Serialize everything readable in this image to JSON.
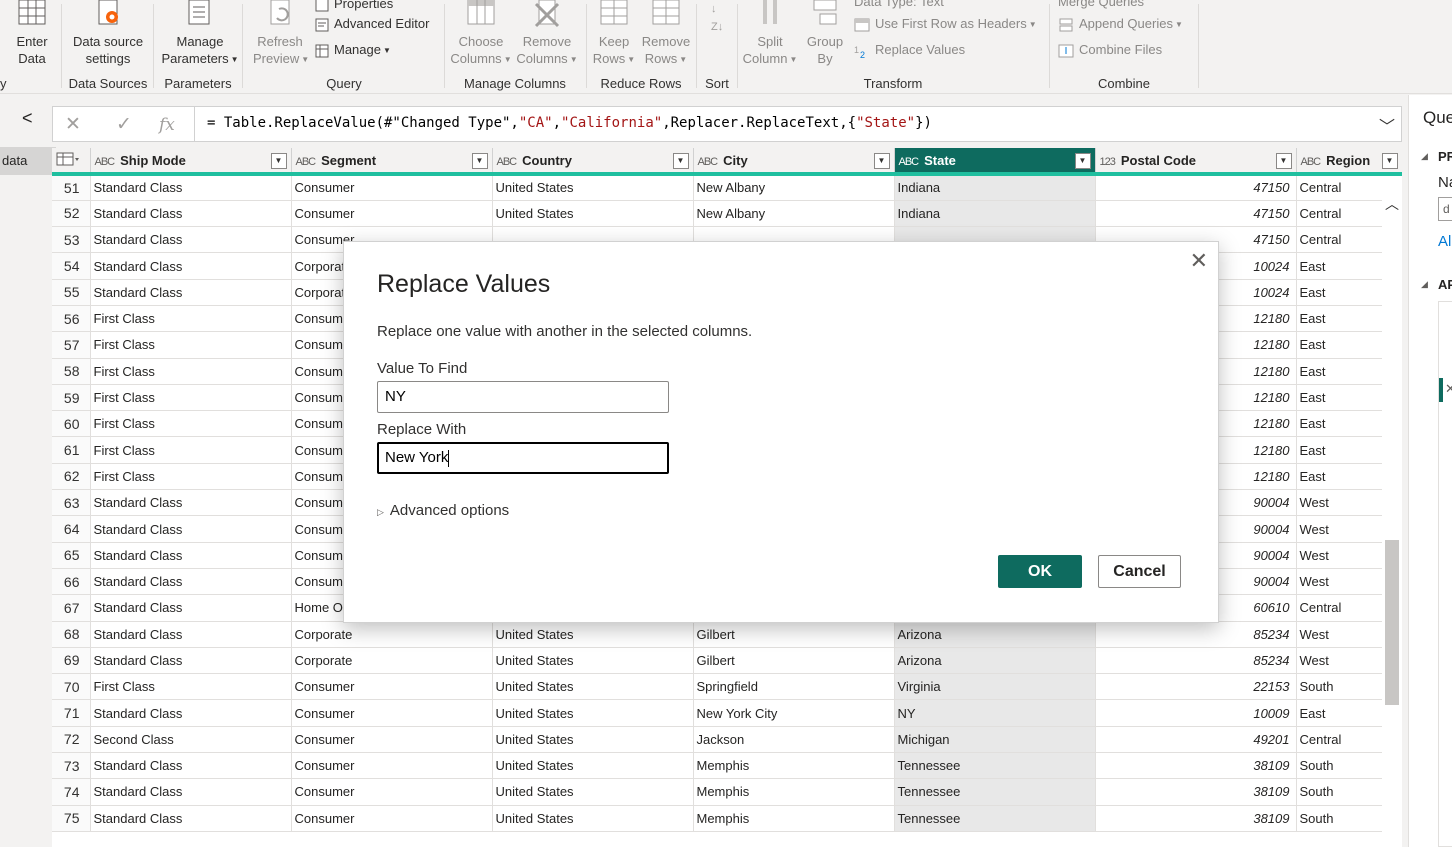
{
  "ribbon": {
    "enter_data": "Enter\nData",
    "data_source_settings": "Data source\nsettings",
    "manage_parameters": "Manage\nParameters",
    "refresh_preview": "Refresh\nPreview",
    "properties": "Properties",
    "advanced_editor": "Advanced Editor",
    "manage": "Manage",
    "choose_columns": "Choose\nColumns",
    "remove_columns": "Remove\nColumns",
    "keep_rows": "Keep\nRows",
    "remove_rows": "Remove\nRows",
    "split_column": "Split\nColumn",
    "group_by": "Group\nBy",
    "data_type": "Data Type: Text",
    "use_first_row": "Use First Row as Headers",
    "replace_values": "Replace Values",
    "merge_queries": "Merge Queries",
    "append_queries": "Append Queries",
    "combine_files": "Combine Files",
    "groups": {
      "first": "y",
      "data_sources": "Data Sources",
      "parameters": "Parameters",
      "query": "Query",
      "manage_columns": "Manage Columns",
      "reduce_rows": "Reduce Rows",
      "sort": "Sort",
      "transform": "Transform",
      "combine": "Combine"
    }
  },
  "left_pane": {
    "item": "data"
  },
  "formula_bar": {
    "fx": "fx",
    "prefix": "= Table.ReplaceValue(#\"Changed Type\",",
    "s1": "\"CA\"",
    "comma1": ",",
    "s2": "\"California\"",
    "mid": ",Replacer.ReplaceText,{",
    "s3": "\"State\"",
    "suffix": "})"
  },
  "grid": {
    "columns": [
      {
        "type": "ABC",
        "name": "Ship Mode"
      },
      {
        "type": "ABC",
        "name": "Segment"
      },
      {
        "type": "ABC",
        "name": "Country"
      },
      {
        "type": "ABC",
        "name": "City"
      },
      {
        "type": "ABC",
        "name": "State",
        "selected": true
      },
      {
        "type": "123",
        "name": "Postal Code"
      },
      {
        "type": "ABC",
        "name": "Region"
      }
    ],
    "rows": [
      [
        "51",
        "Standard Class",
        "Consumer",
        "United States",
        "New Albany",
        "Indiana",
        "47150",
        "Central"
      ],
      [
        "52",
        "Standard Class",
        "Consumer",
        "United States",
        "New Albany",
        "Indiana",
        "47150",
        "Central"
      ],
      [
        "53",
        "Standard Class",
        "Consumer",
        "",
        "",
        "",
        "47150",
        "Central"
      ],
      [
        "54",
        "Standard Class",
        "Corporate",
        "",
        "",
        "",
        "10024",
        "East"
      ],
      [
        "55",
        "Standard Class",
        "Corporate",
        "",
        "",
        "",
        "10024",
        "East"
      ],
      [
        "56",
        "First Class",
        "Consumer",
        "",
        "",
        "",
        "12180",
        "East"
      ],
      [
        "57",
        "First Class",
        "Consumer",
        "",
        "",
        "",
        "12180",
        "East"
      ],
      [
        "58",
        "First Class",
        "Consumer",
        "",
        "",
        "",
        "12180",
        "East"
      ],
      [
        "59",
        "First Class",
        "Consumer",
        "",
        "",
        "",
        "12180",
        "East"
      ],
      [
        "60",
        "First Class",
        "Consumer",
        "",
        "",
        "",
        "12180",
        "East"
      ],
      [
        "61",
        "First Class",
        "Consumer",
        "",
        "",
        "",
        "12180",
        "East"
      ],
      [
        "62",
        "First Class",
        "Consumer",
        "",
        "",
        "",
        "12180",
        "East"
      ],
      [
        "63",
        "Standard Class",
        "Consumer",
        "",
        "",
        "",
        "90004",
        "West"
      ],
      [
        "64",
        "Standard Class",
        "Consumer",
        "",
        "",
        "",
        "90004",
        "West"
      ],
      [
        "65",
        "Standard Class",
        "Consumer",
        "",
        "",
        "",
        "90004",
        "West"
      ],
      [
        "66",
        "Standard Class",
        "Consumer",
        "",
        "",
        "",
        "90004",
        "West"
      ],
      [
        "67",
        "Standard Class",
        "Home Office",
        "",
        "",
        "",
        "60610",
        "Central"
      ],
      [
        "68",
        "Standard Class",
        "Corporate",
        "United States",
        "Gilbert",
        "Arizona",
        "85234",
        "West"
      ],
      [
        "69",
        "Standard Class",
        "Corporate",
        "United States",
        "Gilbert",
        "Arizona",
        "85234",
        "West"
      ],
      [
        "70",
        "First Class",
        "Consumer",
        "United States",
        "Springfield",
        "Virginia",
        "22153",
        "South"
      ],
      [
        "71",
        "Standard Class",
        "Consumer",
        "United States",
        "New York City",
        "NY",
        "10009",
        "East"
      ],
      [
        "72",
        "Second Class",
        "Consumer",
        "United States",
        "Jackson",
        "Michigan",
        "49201",
        "Central"
      ],
      [
        "73",
        "Standard Class",
        "Consumer",
        "United States",
        "Memphis",
        "Tennessee",
        "38109",
        "South"
      ],
      [
        "74",
        "Standard Class",
        "Consumer",
        "United States",
        "Memphis",
        "Tennessee",
        "38109",
        "South"
      ],
      [
        "75",
        "Standard Class",
        "Consumer",
        "United States",
        "Memphis",
        "Tennessee",
        "38109",
        "South"
      ]
    ]
  },
  "right_pane": {
    "title": "Que",
    "props": "PR",
    "name": "Na",
    "field": "d",
    "all": "All",
    "applied": "AP"
  },
  "dialog": {
    "title": "Replace Values",
    "description": "Replace one value with another in the selected columns.",
    "find_label": "Value To Find",
    "find_value": "NY",
    "replace_label": "Replace With",
    "replace_value": "New York",
    "advanced": "Advanced options",
    "ok": "OK",
    "cancel": "Cancel"
  }
}
